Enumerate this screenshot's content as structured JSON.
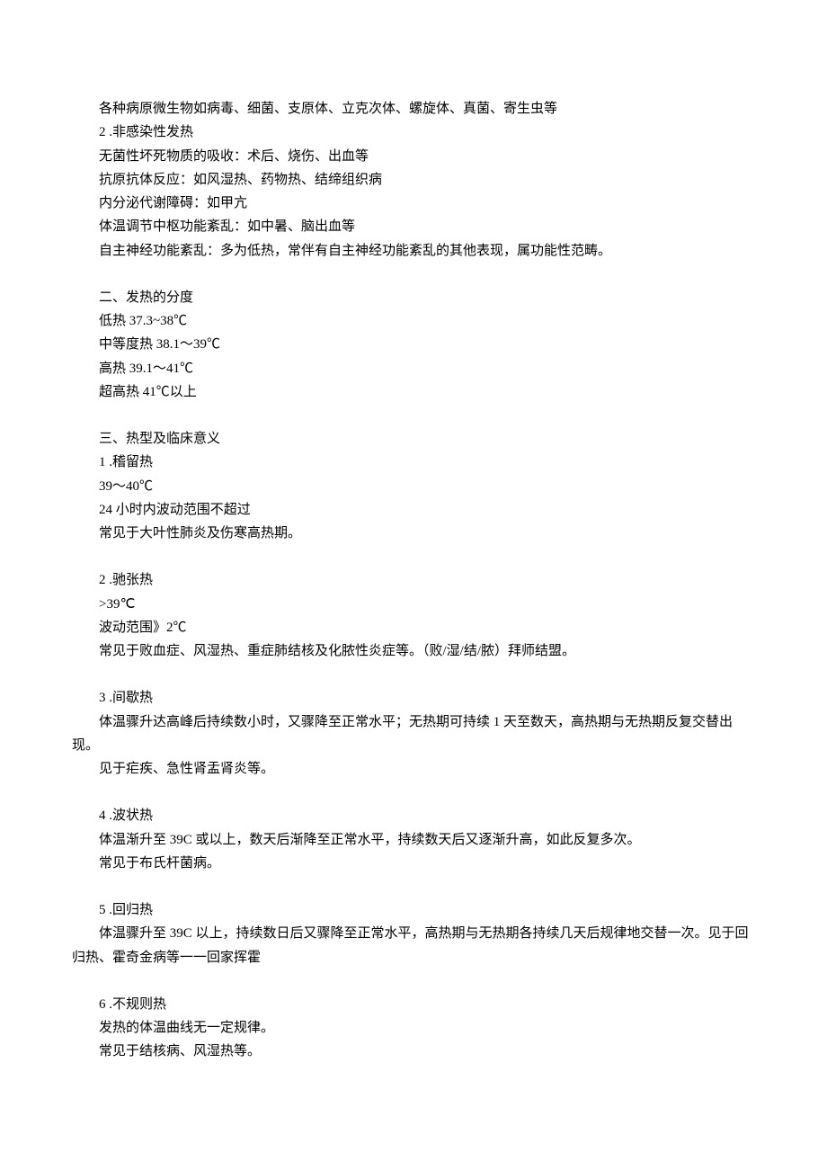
{
  "lines": [
    "各种病原微生物如病毒、细菌、支原体、立克次体、螺旋体、真菌、寄生虫等",
    "2 .非感染性发热",
    "无菌性坏死物质的吸收：术后、烧伤、出血等",
    "抗原抗体反应：如风湿热、药物热、结缔组织病",
    "内分泌代谢障碍：如甲亢",
    "体温调节中枢功能紊乱：如中暑、脑出血等",
    "自主神经功能紊乱：多为低热，常伴有自主神经功能紊乱的其他表现，属功能性范畴。",
    "",
    "二、发热的分度",
    "低热 37.3~38℃",
    "中等度热 38.1～39℃",
    "高热 39.1～41℃",
    "超高热 41℃以上",
    "",
    "三、热型及临床意义",
    "1 .稽留热",
    "39～40℃",
    "24 小时内波动范围不超过",
    "常见于大叶性肺炎及伤寒高热期。",
    "",
    "2 .驰张热",
    ">39℃",
    "波动范围》2℃",
    "常见于败血症、风湿热、重症肺结核及化脓性炎症等。（败/湿/结/脓）拜师结盟。",
    "",
    "3 .间歇热",
    "体温骤升达高峰后持续数小时，又骤降至正常水平；无热期可持续 1 天至数天，高热期与无热期反复交替出现。",
    "见于疟疾、急性肾盂肾炎等。",
    "",
    "4 .波状热",
    "体温渐升至 39C 或以上，数天后渐降至正常水平，持续数天后又逐渐升高，如此反复多次。",
    "常见于布氏杆菌病。",
    "",
    "5 .回归热",
    "体温骤升至 39C 以上，持续数日后又骤降至正常水平，高热期与无热期各持续几天后规律地交替一次。见于回归热、霍奇金病等一一回家挥霍",
    "",
    "6 .不规则热",
    "发热的体温曲线无一定规律。",
    "常见于结核病、风湿热等。"
  ],
  "wrap_no_indent_after": [
    26,
    34
  ]
}
